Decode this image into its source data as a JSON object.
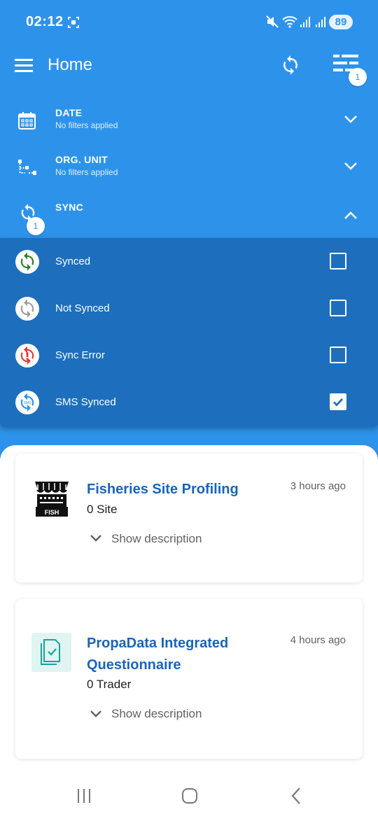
{
  "status_bar": {
    "time": "02:12",
    "battery": "89",
    "icons": [
      "screenshot-icon",
      "mute-icon",
      "wifi-icon",
      "signal-icon",
      "signal-icon"
    ]
  },
  "app_bar": {
    "title": "Home",
    "filter_badge": "1",
    "icons": [
      "menu-icon",
      "sync-icon",
      "filter-icon"
    ]
  },
  "filters": [
    {
      "title": "DATE",
      "subtitle": "No filters applied",
      "icon": "calendar-icon",
      "expanded": false
    },
    {
      "title": "ORG. UNIT",
      "subtitle": "No filters applied",
      "icon": "org-unit-icon",
      "expanded": false
    },
    {
      "title": "SYNC",
      "subtitle": "",
      "icon": "sync-icon",
      "badge": "1",
      "expanded": true
    }
  ],
  "sync_options": [
    {
      "label": "Synced",
      "checked": false,
      "color": "#2e7d32"
    },
    {
      "label": "Not Synced",
      "checked": false,
      "color": "#9e9e9e"
    },
    {
      "label": "Sync Error",
      "checked": false,
      "color": "#e53935"
    },
    {
      "label": "SMS Synced",
      "checked": true,
      "color": "#2d93ea"
    }
  ],
  "programs": [
    {
      "title": "Fisheries Site Profiling",
      "time": "3 hours ago",
      "count": "0 Site",
      "show_description": "Show description",
      "icon": "fish-market-icon"
    },
    {
      "title": "PropaData Integrated Questionnaire",
      "time": "4 hours ago",
      "count": "0 Trader",
      "show_description": "Show description",
      "icon": "questionnaire-icon"
    }
  ],
  "colors": {
    "primary": "#2d93ea",
    "panel": "#1d6fbd",
    "title_blue": "#1b64b8"
  }
}
